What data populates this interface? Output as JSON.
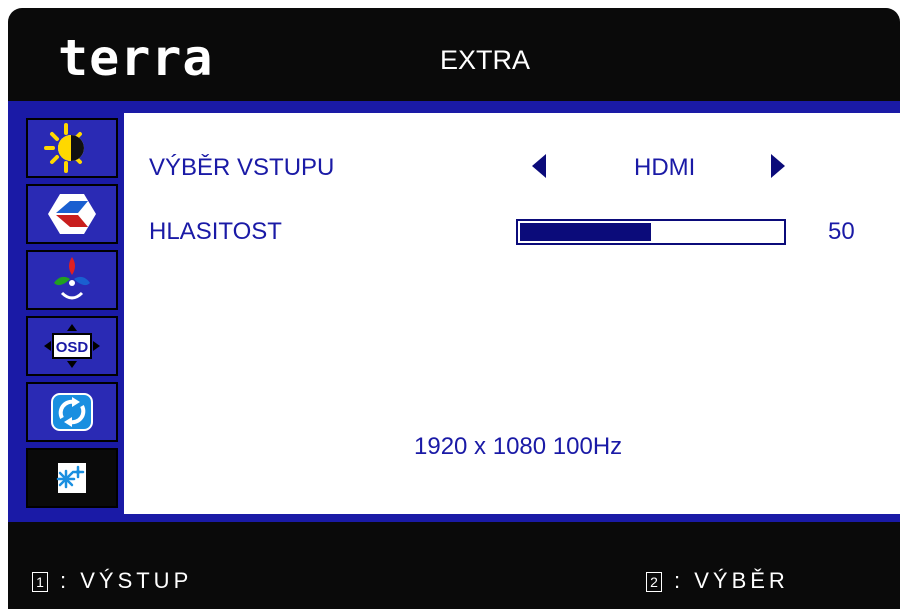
{
  "header": {
    "logo": "terra",
    "title": "EXTRA"
  },
  "sidebar": {
    "items": [
      {
        "icon": "brightness-icon"
      },
      {
        "icon": "image-icon"
      },
      {
        "icon": "color-icon"
      },
      {
        "icon": "osd-icon"
      },
      {
        "icon": "reset-icon"
      },
      {
        "icon": "extra-icon",
        "active": true
      }
    ],
    "osd_icon_text": "OSD"
  },
  "content": {
    "input_label": "VÝBĚR VSTUPU",
    "input_value": "HDMI",
    "volume_label": "HLASITOST",
    "volume_value": "50",
    "volume_level": 0.5,
    "resolution": "1920 x 1080 100Hz"
  },
  "footer": {
    "key1": "1",
    "key1_label": ": VÝSTUP",
    "key2": "2",
    "key2_label": ": VÝBĚR"
  },
  "colors": {
    "accent": "#1a1aa6",
    "dark_blue": "#0b0b7a",
    "background": "#0a0a0a"
  }
}
